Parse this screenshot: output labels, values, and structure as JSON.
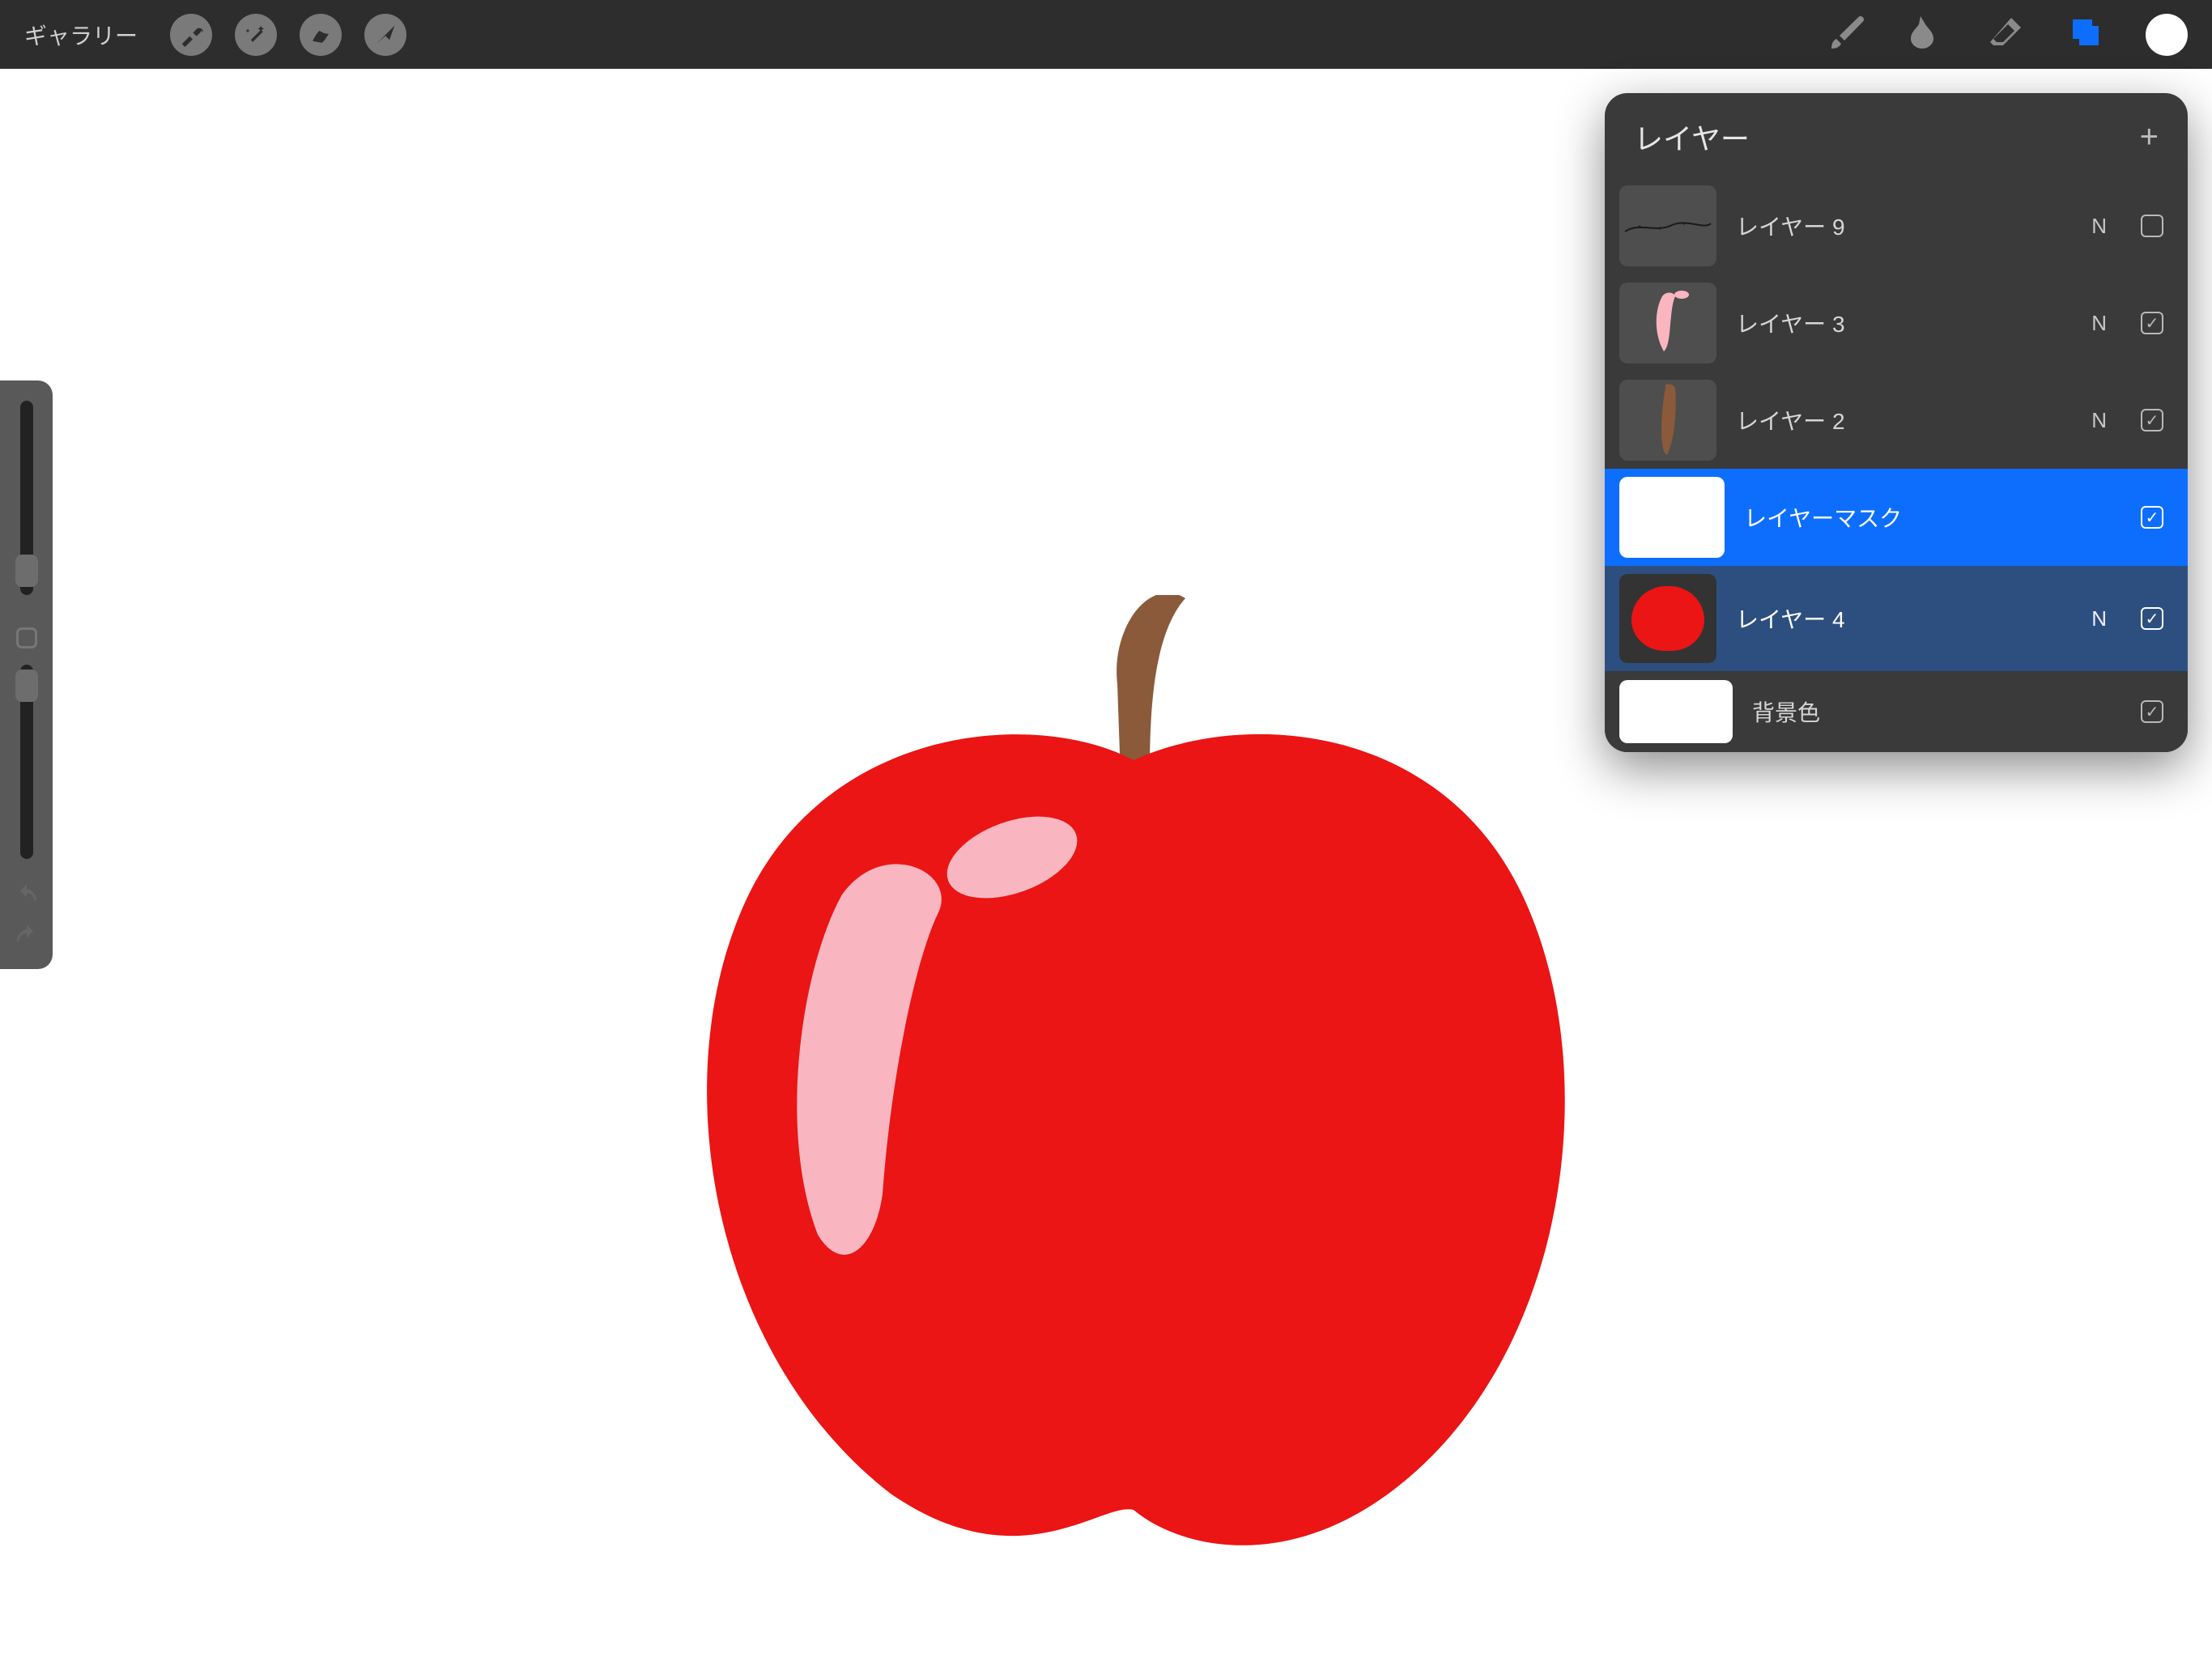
{
  "app": {
    "gallery_label": "ギャラリー"
  },
  "toolbar": {
    "wrench_icon": "wrench-icon",
    "wand_icon": "wand-icon",
    "selection_icon": "selection-icon",
    "arrow_icon": "arrow-icon",
    "brush_icon": "brush-icon",
    "smudge_icon": "smudge-icon",
    "eraser_icon": "eraser-icon",
    "layers_icon": "layers-icon",
    "color": "#ffffff"
  },
  "layers_panel": {
    "title": "レイヤー",
    "add_label": "+",
    "rows": [
      {
        "label": "レイヤー 9",
        "blend": "N",
        "visible": false
      },
      {
        "label": "レイヤー 3",
        "blend": "N",
        "visible": true
      },
      {
        "label": "レイヤー 2",
        "blend": "N",
        "visible": true
      },
      {
        "label": "レイヤーマスク",
        "blend": "",
        "visible": true
      },
      {
        "label": "レイヤー 4",
        "blend": "N",
        "visible": true
      },
      {
        "label": "背景色",
        "blend": "",
        "visible": true
      }
    ]
  },
  "colors": {
    "apple_body": "#ea1514",
    "apple_highlight": "#f9b6c1",
    "apple_stem": "#8a5a3a",
    "accent": "#0d6efd"
  }
}
